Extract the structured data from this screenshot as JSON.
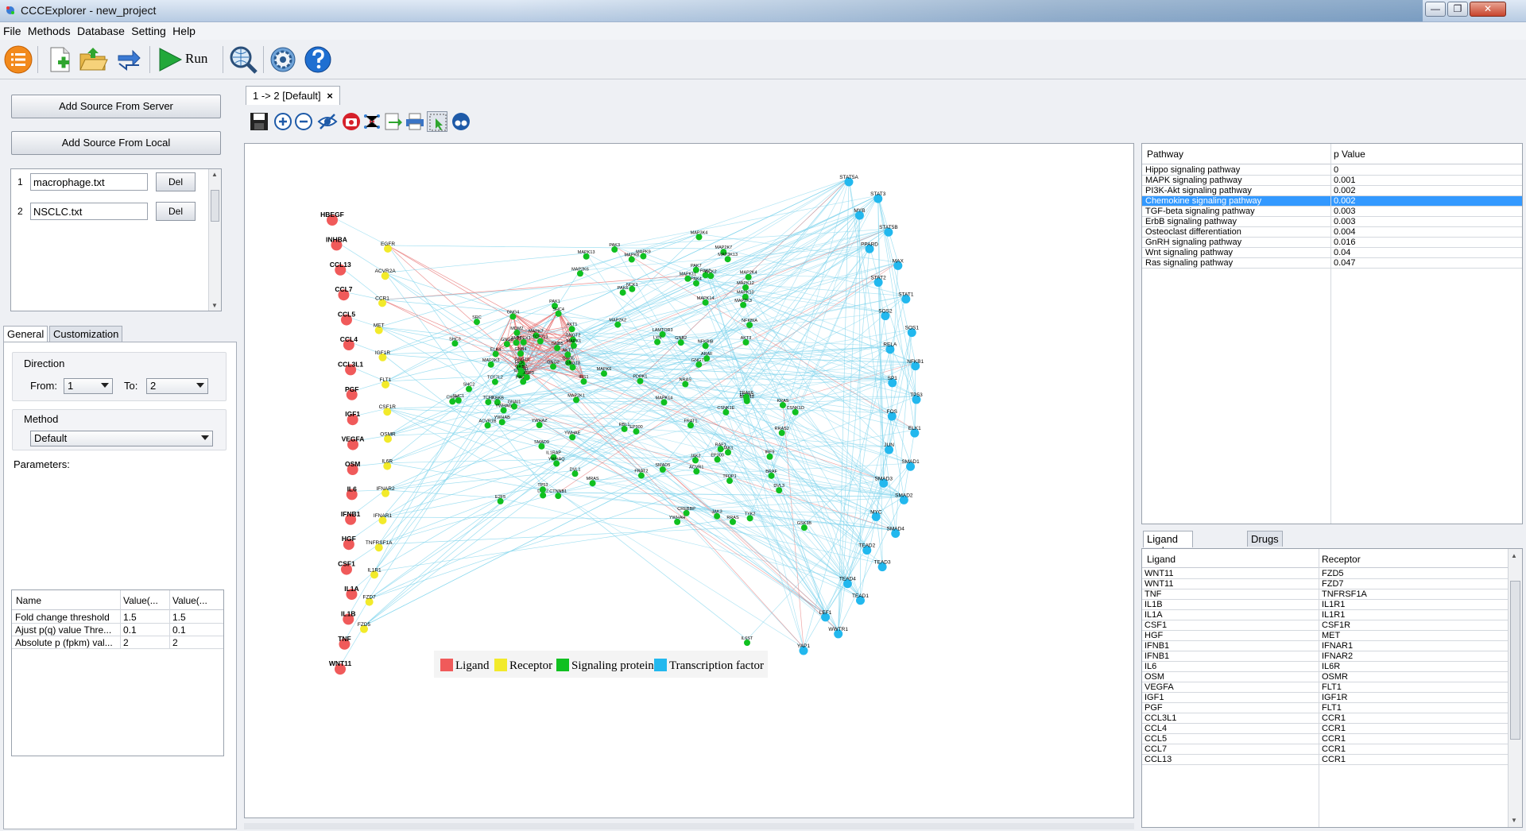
{
  "window": {
    "title": "CCCExplorer - new_project"
  },
  "menu": [
    "File",
    "Methods",
    "Database",
    "Setting",
    "Help"
  ],
  "toolbar": {
    "run_label": "Run"
  },
  "sources": {
    "add_server": "Add Source From Server",
    "add_local": "Add Source From Local",
    "files": [
      {
        "num": "1",
        "name": "macrophage.txt",
        "del": "Del"
      },
      {
        "num": "2",
        "name": "NSCLC.txt",
        "del": "Del"
      }
    ]
  },
  "settings": {
    "tabs": [
      "General",
      "Customization"
    ],
    "direction_label": "Direction",
    "from_label": "From:",
    "from_value": "1",
    "to_label": "To:",
    "to_value": "2",
    "method_label": "Method",
    "method_value": "Default",
    "parameters_label": "Parameters:",
    "param_headers": [
      "Name",
      "Value(...",
      "Value(..."
    ],
    "params": [
      [
        "Fold change threshold",
        "1.5",
        "1.5"
      ],
      [
        "Ajust p(q) value Thre...",
        "0.1",
        "0.1"
      ],
      [
        "Absolute p (fpkm) val...",
        "2",
        "2"
      ]
    ]
  },
  "document_tab": "1 -> 2 [Default]",
  "network": {
    "colors": {
      "ligand": "#f05a5a",
      "receptor": "#f2ea2a",
      "signaling": "#10c020",
      "tf": "#22b8ee",
      "edge_red": "#e56b6b",
      "edge_blue": "#7fd4ec"
    },
    "legend": [
      "Ligand",
      "Receptor",
      "Signaling protein",
      "Transcription factor"
    ],
    "ligands": [
      "HBEGF",
      "INHBA",
      "CCL13",
      "CCL7",
      "CCL5",
      "CCL4",
      "CCL3L1",
      "PGF",
      "IGF1",
      "VEGFA",
      "OSM",
      "IL6",
      "IFNB1",
      "HGF",
      "CSF1",
      "IL1A",
      "IL1B",
      "TNF",
      "WNT11"
    ],
    "receptors": [
      "EGFR",
      "ACVR2A",
      "CCR1",
      "MET",
      "IGF1R",
      "FLT1",
      "CSF1R",
      "OSMR",
      "IL6R",
      "IFNAR2",
      "IFNAR1",
      "TNFRSF1A",
      "IL1R1",
      "FZD7",
      "FZD5"
    ],
    "tfs": [
      "STAT5A",
      "STAT3",
      "MYB",
      "STAT5B",
      "PPARD",
      "MAX",
      "STAT2",
      "STAT1",
      "SOS2",
      "SOS1",
      "RELA",
      "NFKB1",
      "SP1",
      "TP53",
      "FOS",
      "ELK1",
      "JUN",
      "SMAD1",
      "SMAD3",
      "SMAD2",
      "MYC",
      "SMAD4",
      "TEAD2",
      "TEAD3",
      "TEAD4",
      "TEAD1",
      "LEF1",
      "WWTR1",
      "YAP1"
    ],
    "signaling": [
      "PAK1",
      "PAK3",
      "PAK2",
      "PAK6",
      "NCK2",
      "PAK4",
      "MAP2K7",
      "NCK1",
      "MAP3K4",
      "PAK7",
      "MAPK10",
      "MAP2K6",
      "MAPK12",
      "MAPK11",
      "MAP2K3",
      "MAPK8",
      "MAP3K13",
      "MAPK13",
      "MAPK9",
      "MAP2K4",
      "MAPK14",
      "GNG5",
      "GNG8",
      "GNG10",
      "GNB5",
      "GNB1",
      "GNG4",
      "GNB4",
      "HCK",
      "GNG3",
      "PIK3R1",
      "PREX1",
      "GNGT2",
      "AKT1",
      "MDM2",
      "ELK4",
      "MAPK1",
      "MAPK7",
      "TAB1",
      "CASP3",
      "SHC4",
      "IRS1",
      "GNG13",
      "GNG2",
      "AKT2",
      "LAMTOR3",
      "MAPK6",
      "IKBKB",
      "ERBB2",
      "GNG12",
      "NFKBIB",
      "SHC3",
      "SRC",
      "LYN",
      "GNGT1",
      "GNB2",
      "AKT3",
      "MAP2K1",
      "MAP3K3",
      "CHUK",
      "MAPK14",
      "SHC1",
      "GNAI1",
      "PDPK1",
      "TCF7L1",
      "GRB2",
      "SHC2",
      "NRAS",
      "MAP2K2",
      "TCF7",
      "TCF7L2",
      "NFKBIA",
      "TRAF6",
      "KRAS",
      "ARAF",
      "CTNNB1",
      "IRF9",
      "IL1RAP",
      "BRAF",
      "MRAS",
      "RAF1",
      "EP300",
      "SMAD9",
      "GSK3B",
      "CREBBP",
      "RRAS2",
      "FRAT1",
      "FRAT2",
      "RRAS",
      "EP300",
      "RBL1",
      "ACVR1",
      "SMAD5",
      "JAK1",
      "CSNK1E",
      "DVL1",
      "DVL2",
      "YWHAE",
      "JAK2",
      "E2F5",
      "TYK2",
      "DVL3",
      "CSNK1D",
      "TFDP1",
      "JAK3",
      "ACVR1B",
      "YWHAB",
      "YWHAG",
      "YWHAH",
      "YWHAZ",
      "TP53",
      "YWHAQ",
      "IL6ST"
    ]
  },
  "pathways": {
    "headers": [
      "Pathway",
      "p Value"
    ],
    "rows": [
      [
        "Hippo signaling pathway",
        "0"
      ],
      [
        "MAPK signaling pathway",
        "0.001"
      ],
      [
        "PI3K-Akt signaling pathway",
        "0.002"
      ],
      [
        "Chemokine signaling pathway",
        "0.002"
      ],
      [
        "TGF-beta signaling pathway",
        "0.003"
      ],
      [
        "ErbB signaling pathway",
        "0.003"
      ],
      [
        "Osteoclast differentiation",
        "0.004"
      ],
      [
        "GnRH signaling pathway",
        "0.016"
      ],
      [
        "Wnt signaling pathway",
        "0.04"
      ],
      [
        "Ras signaling pathway",
        "0.047"
      ]
    ],
    "selected_index": 3
  },
  "lr": {
    "tabs": [
      "Ligand and Receptor",
      "Drugs"
    ],
    "headers": [
      "Ligand",
      "Receptor"
    ],
    "rows": [
      [
        "WNT11",
        "FZD5"
      ],
      [
        "WNT11",
        "FZD7"
      ],
      [
        "TNF",
        "TNFRSF1A"
      ],
      [
        "IL1B",
        "IL1R1"
      ],
      [
        "IL1A",
        "IL1R1"
      ],
      [
        "CSF1",
        "CSF1R"
      ],
      [
        "HGF",
        "MET"
      ],
      [
        "IFNB1",
        "IFNAR1"
      ],
      [
        "IFNB1",
        "IFNAR2"
      ],
      [
        "IL6",
        "IL6R"
      ],
      [
        "OSM",
        "OSMR"
      ],
      [
        "VEGFA",
        "FLT1"
      ],
      [
        "IGF1",
        "IGF1R"
      ],
      [
        "PGF",
        "FLT1"
      ],
      [
        "CCL3L1",
        "CCR1"
      ],
      [
        "CCL4",
        "CCR1"
      ],
      [
        "CCL5",
        "CCR1"
      ],
      [
        "CCL7",
        "CCR1"
      ],
      [
        "CCL13",
        "CCR1"
      ]
    ]
  }
}
